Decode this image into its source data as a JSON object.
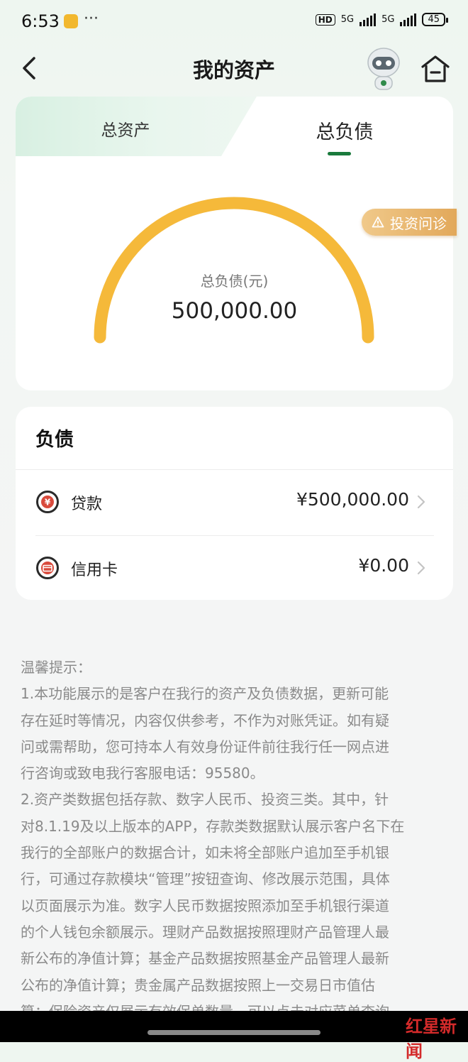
{
  "status_bar": {
    "time": "6:53",
    "dots": "···",
    "hd": "HD",
    "net1": "5G",
    "net2": "5G",
    "battery": "45"
  },
  "nav": {
    "title": "我的资产"
  },
  "tabs": [
    {
      "label": "总资产",
      "active": false
    },
    {
      "label": "总负债",
      "active": true
    }
  ],
  "gauge": {
    "label": "总负债(元)",
    "value": "500,000.00",
    "fill_fraction": 1.0,
    "color": "#f5b93a"
  },
  "advice_button": {
    "label": "投资问诊"
  },
  "liabilities": {
    "title": "负债",
    "rows": [
      {
        "label": "贷款",
        "amount": "¥500,000.00",
        "icon": "yuan-icon"
      },
      {
        "label": "信用卡",
        "amount": "¥0.00",
        "icon": "credit-card-icon"
      }
    ]
  },
  "tips": {
    "lines": [
      "温馨提示：",
      "1.本功能展示的是客户在我行的资产及负债数据，更新可能",
      "存在延时等情况，内容仅供参考，不作为对账凭证。如有疑",
      "问或需帮助，您可持本人有效身份证件前往我行任一网点进",
      "行咨询或致电我行客服电话：95580。",
      "2.资产类数据包括存款、数字人民币、投资三类。其中，针",
      "对8.1.19及以上版本的APP，存款类数据默认展示客户名下在",
      "我行的全部账户的数据合计，如未将全部账户追加至手机银",
      "行，可通过存款模块“管理”按钮查询、修改展示范围，具体",
      "以页面展示为准。数字人民币数据按照添加至手机银行渠道",
      "的个人钱包余额展示。理财产品数据按照理财产品管理人最",
      "新公布的净值计算；基金产品数据按照基金产品管理人最新",
      "公布的净值计算；贵金属产品数据按照上一交易日市值估",
      "算；保险资产仅展示有效保单数量，可以点击对应菜单查询"
    ]
  },
  "watermark": {
    "text": "红星新闻"
  },
  "colors": {
    "accent_green": "#1a7a3c",
    "gauge_orange": "#f5b93a",
    "advice_orange": "#e2a85a"
  }
}
